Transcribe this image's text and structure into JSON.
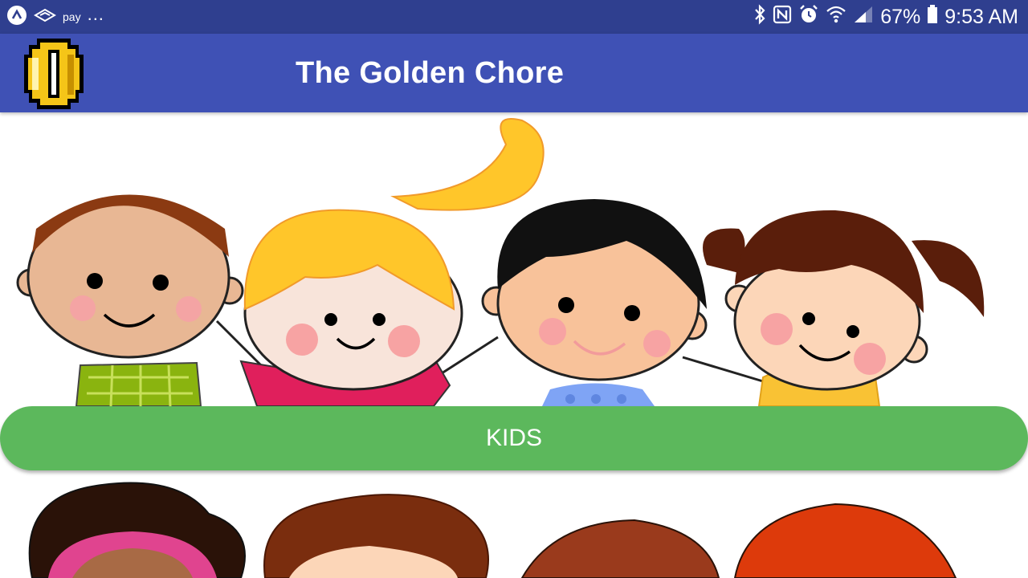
{
  "status_bar": {
    "pay_label": "pay",
    "more": "...",
    "battery": "67%",
    "time": "9:53 AM",
    "icons": [
      "app-icon",
      "samsung-pay-icon",
      "bluetooth-icon",
      "nfc-icon",
      "alarm-icon",
      "wifi-icon",
      "signal-icon",
      "battery-icon"
    ]
  },
  "app_bar": {
    "title": "The Golden Chore",
    "logo": "gold-coin-icon"
  },
  "main": {
    "kids_button_label": "KIDS"
  },
  "colors": {
    "status_bar": "#2f3f8f",
    "app_bar": "#3f51b5",
    "kids_button": "#5cb85c"
  }
}
